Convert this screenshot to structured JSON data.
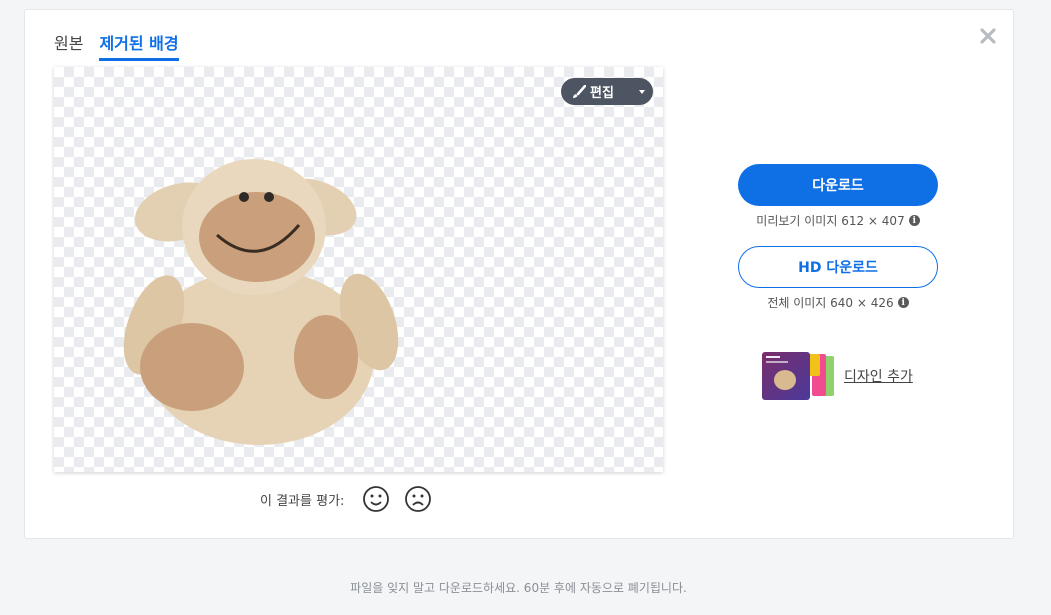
{
  "tabs": [
    {
      "label": "원본",
      "active": false
    },
    {
      "label": "제거된 배경",
      "active": true
    }
  ],
  "editor": {
    "edit_label": "편집"
  },
  "rating": {
    "label": "이 결과를 평가:"
  },
  "download": {
    "primary_label": "다운로드",
    "primary_caption": "미리보기 이미지 612 × 407",
    "hd_label": "HD 다운로드",
    "hd_caption": "전체 이미지 640 × 426",
    "info_glyph": "i"
  },
  "design": {
    "link_label": "디자인 추가"
  },
  "footer": {
    "notice": "파일을 잊지 말고 다운로드하세요. 60분 후에 자동으로 폐기됩니다."
  },
  "colors": {
    "accent": "#0f70e6",
    "edit_button": "#4c5561",
    "background": "#f4f5f7"
  },
  "icons": [
    "close-icon",
    "brush-icon",
    "caret-down-icon",
    "smile-icon",
    "frown-icon",
    "info-icon"
  ]
}
